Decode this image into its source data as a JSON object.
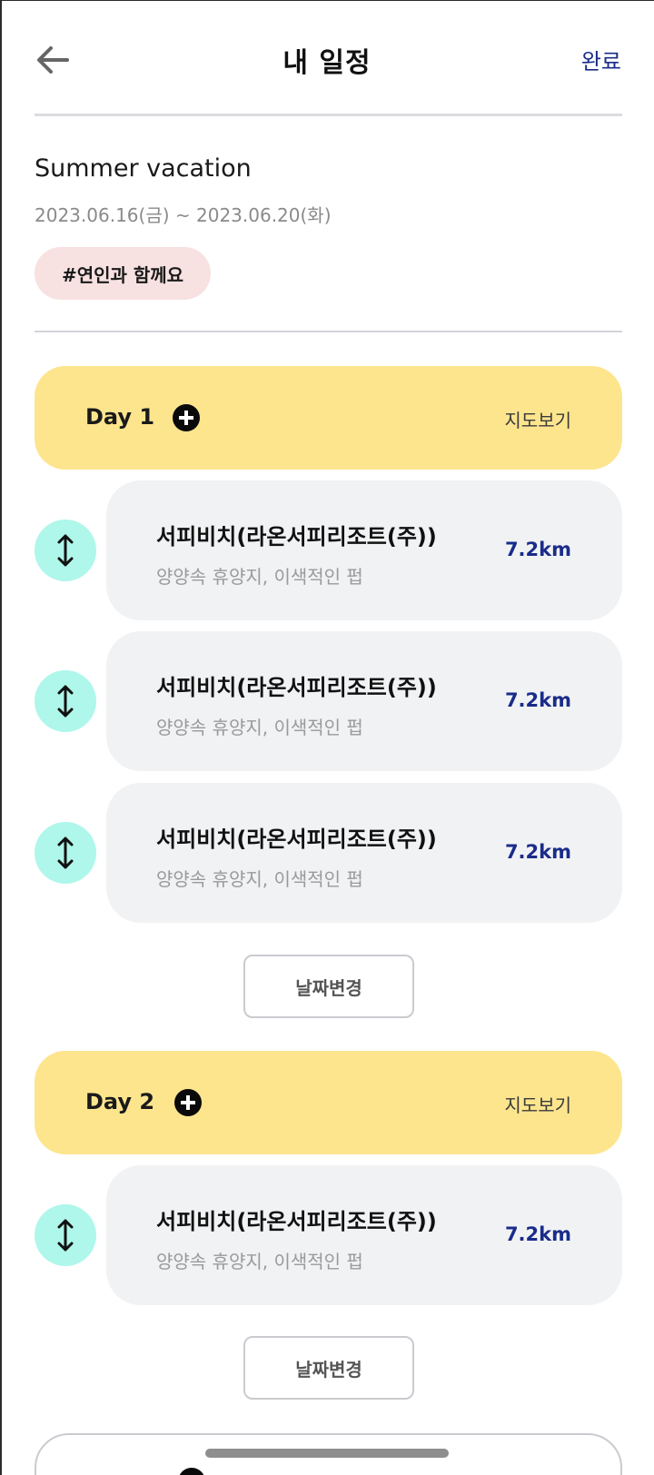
{
  "header": {
    "title": "내 일정",
    "done_label": "완료",
    "back_icon": "arrow-left-icon"
  },
  "trip": {
    "title": "Summer vacation",
    "dates": "2023.06.16(금) ~ 2023.06.20(화)",
    "tag": "#연인과 함께요"
  },
  "days": [
    {
      "label": "Day 1",
      "map_label": "지도보기",
      "change_date_label": "날짜변경",
      "places": [
        {
          "name": "서피비치(라온서피리조트(주))",
          "desc": "양양속 휴양지, 이색적인 펍",
          "distance": "7.2km"
        },
        {
          "name": "서피비치(라온서피리조트(주))",
          "desc": "양양속 휴양지, 이색적인 펍",
          "distance": "7.2km"
        },
        {
          "name": "서피비치(라온서피리조트(주))",
          "desc": "양양속 휴양지, 이색적인 펍",
          "distance": "7.2km"
        }
      ]
    },
    {
      "label": "Day 2",
      "map_label": "지도보기",
      "change_date_label": "날짜변경",
      "places": [
        {
          "name": "서피비치(라온서피리조트(주))",
          "desc": "양양속 휴양지, 이색적인 펍",
          "distance": "7.2km"
        }
      ]
    }
  ],
  "colors": {
    "accent": "#1a2c8a",
    "day_header_bg": "#fde58e",
    "drag_handle_bg": "#aef7ea",
    "tag_bg": "#f7e1e1",
    "card_bg": "#f1f2f4"
  }
}
